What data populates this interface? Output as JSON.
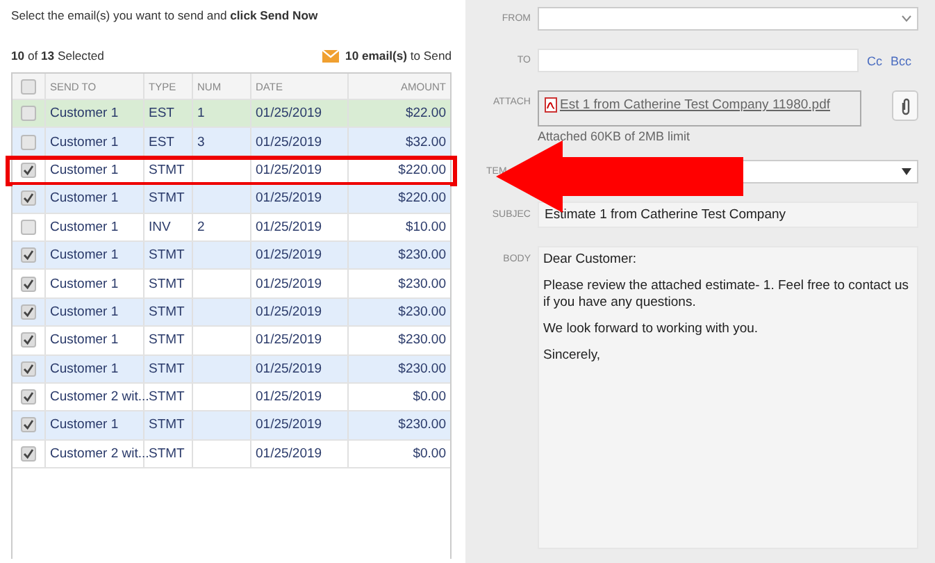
{
  "instruction": "Select the email(s) you want to send and **click Send Now**",
  "selected_count": "**10** of **13** Selected",
  "to_send": "**10 email(s)** to Send",
  "table": {
    "select_all_checked": false,
    "columns": [
      "SEND TO",
      "TYPE",
      "NUM",
      "DATE",
      "AMOUNT"
    ],
    "rows": [
      {
        "checked": false,
        "highlighted": true,
        "boxed": false,
        "cells": [
          "Customer 1",
          "EST",
          "1",
          "01/25/2019",
          "$22.00"
        ]
      },
      {
        "checked": false,
        "highlighted": false,
        "boxed": false,
        "cells": [
          "Customer 1",
          "EST",
          "3",
          "01/25/2019",
          "$32.00"
        ]
      },
      {
        "checked": true,
        "highlighted": false,
        "boxed": true,
        "cells": [
          "Customer 1",
          "STMT",
          "",
          "01/25/2019",
          "$220.00"
        ]
      },
      {
        "checked": true,
        "highlighted": false,
        "boxed": false,
        "cells": [
          "Customer 1",
          "STMT",
          "",
          "01/25/2019",
          "$220.00"
        ]
      },
      {
        "checked": false,
        "highlighted": false,
        "boxed": false,
        "cells": [
          "Customer 1",
          "INV",
          "2",
          "01/25/2019",
          "$10.00"
        ]
      },
      {
        "checked": true,
        "highlighted": false,
        "boxed": false,
        "cells": [
          "Customer 1",
          "STMT",
          "",
          "01/25/2019",
          "$230.00"
        ]
      },
      {
        "checked": true,
        "highlighted": false,
        "boxed": false,
        "cells": [
          "Customer 1",
          "STMT",
          "",
          "01/25/2019",
          "$230.00"
        ]
      },
      {
        "checked": true,
        "highlighted": false,
        "boxed": false,
        "cells": [
          "Customer 1",
          "STMT",
          "",
          "01/25/2019",
          "$230.00"
        ]
      },
      {
        "checked": true,
        "highlighted": false,
        "boxed": false,
        "cells": [
          "Customer 1",
          "STMT",
          "",
          "01/25/2019",
          "$230.00"
        ]
      },
      {
        "checked": true,
        "highlighted": false,
        "boxed": false,
        "cells": [
          "Customer 1",
          "STMT",
          "",
          "01/25/2019",
          "$230.00"
        ]
      },
      {
        "checked": true,
        "highlighted": false,
        "boxed": false,
        "cells": [
          "Customer 2 wit...",
          "STMT",
          "",
          "01/25/2019",
          "$0.00"
        ]
      },
      {
        "checked": true,
        "highlighted": false,
        "boxed": false,
        "cells": [
          "Customer 1",
          "STMT",
          "",
          "01/25/2019",
          "$230.00"
        ]
      },
      {
        "checked": true,
        "highlighted": false,
        "boxed": false,
        "cells": [
          "Customer 2 wit...",
          "STMT",
          "",
          "01/25/2019",
          "$0.00"
        ]
      }
    ]
  },
  "form": {
    "from_label": "FROM",
    "to_label": "TO",
    "cc": "Cc",
    "bcc": "Bcc",
    "attach_label": "ATTACH",
    "attachment": "Est 1 from Catherine Test Company 11980.pdf",
    "attach_note": "Attached 60KB of 2MB limit",
    "template_label": "TEM",
    "subject_label": "SUBJEC",
    "subject": "Estimate 1 from Catherine Test Company",
    "body_label": "BODY",
    "body": [
      "Dear Customer:",
      "Please review the attached estimate- 1.  Feel free to contact us if you have any questions.",
      "We look forward to working with you.",
      "Sincerely,"
    ]
  }
}
